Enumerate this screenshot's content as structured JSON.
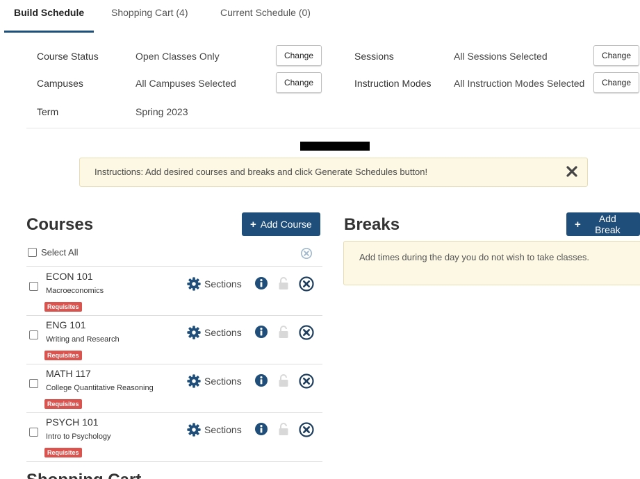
{
  "tabs": [
    {
      "label": "Build Schedule"
    },
    {
      "label": "Shopping Cart (4)"
    },
    {
      "label": "Current Schedule (0)"
    }
  ],
  "filters": {
    "course_status": {
      "label": "Course Status",
      "value": "Open Classes Only",
      "button": "Change"
    },
    "campuses": {
      "label": "Campuses",
      "value": "All Campuses Selected",
      "button": "Change"
    },
    "term": {
      "label": "Term",
      "value": "Spring 2023"
    },
    "sessions": {
      "label": "Sessions",
      "value": "All Sessions Selected",
      "button": "Change"
    },
    "instruction_modes": {
      "label": "Instruction Modes",
      "value": "All Instruction Modes Selected",
      "button": "Change"
    }
  },
  "instructions": {
    "text": "Instructions: Add desired courses and breaks and click Generate Schedules button!"
  },
  "courses": {
    "title": "Courses",
    "add_button": "Add Course",
    "select_all": "Select All",
    "items": [
      {
        "code": "ECON 101",
        "name": "Macroeconomics",
        "badge": "Requisites",
        "sections": "Sections"
      },
      {
        "code": "ENG 101",
        "name": "Writing and Research",
        "badge": "Requisites",
        "sections": "Sections"
      },
      {
        "code": "MATH 117",
        "name": "College Quantitative Reasoning",
        "badge": "Requisites",
        "sections": "Sections"
      },
      {
        "code": "PSYCH 101",
        "name": "Intro to Psychology",
        "badge": "Requisites",
        "sections": "Sections"
      }
    ]
  },
  "breaks": {
    "title": "Breaks",
    "add_button": "Add Break",
    "empty_text": "Add times during the day you do not wish to take classes."
  },
  "next_section": {
    "title": "Shopping Cart"
  },
  "colors": {
    "primary": "#1e4e79",
    "badge": "#d9534f",
    "notice_bg": "#fcf8e3",
    "icon": "#1e4e79"
  }
}
